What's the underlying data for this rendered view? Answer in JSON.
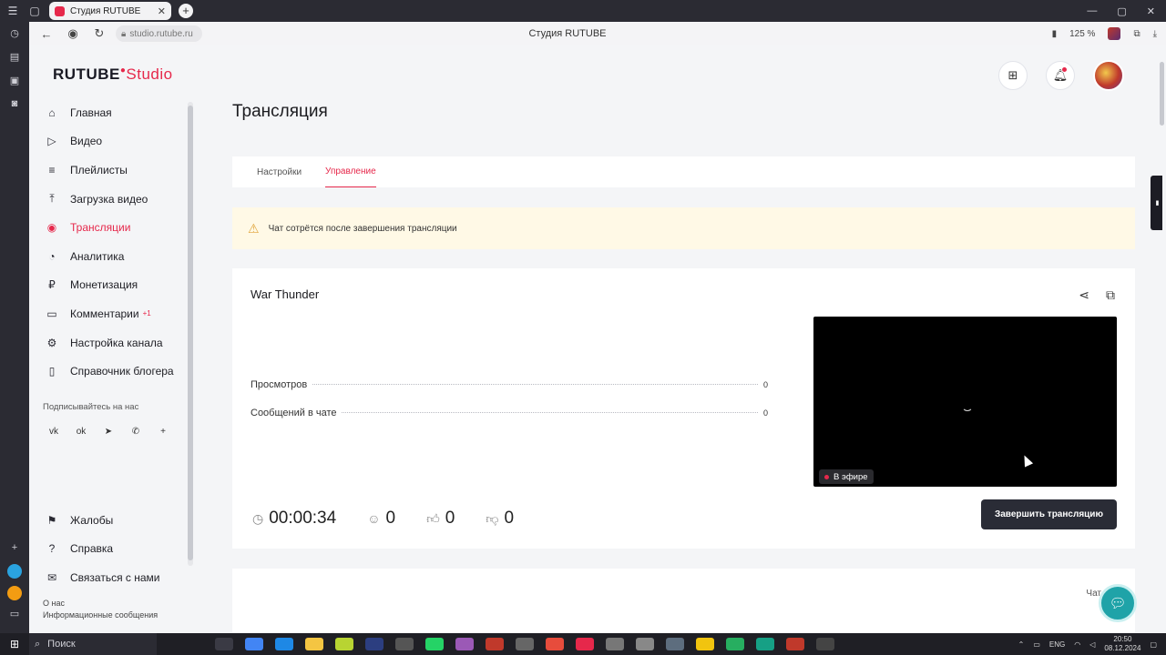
{
  "browser": {
    "tab_title": "Студия RUTUBE",
    "url": "studio.rutube.ru",
    "page_title": "Студия RUTUBE",
    "zoom": "125 %"
  },
  "site": {
    "logo_main": "RUTUBE",
    "logo_sub": "Studio",
    "sidebar": {
      "items": [
        {
          "label": "Главная",
          "icon": "home-icon"
        },
        {
          "label": "Видео",
          "icon": "video-icon"
        },
        {
          "label": "Плейлисты",
          "icon": "list-icon"
        },
        {
          "label": "Загрузка видео",
          "icon": "upload-icon"
        },
        {
          "label": "Трансляции",
          "icon": "broadcast-icon",
          "active": true
        },
        {
          "label": "Аналитика",
          "icon": "analytics-icon"
        },
        {
          "label": "Монетизация",
          "icon": "coin-icon"
        },
        {
          "label": "Комментарии",
          "icon": "comment-icon",
          "badge": "+1"
        },
        {
          "label": "Настройка канала",
          "icon": "settings-icon"
        },
        {
          "label": "Справочник блогера",
          "icon": "book-icon"
        }
      ],
      "subscribe_label": "Подписывайтесь на нас",
      "bottom_items": [
        {
          "label": "Жалобы",
          "icon": "flag-icon"
        },
        {
          "label": "Справка",
          "icon": "help-icon"
        },
        {
          "label": "Связаться с нами",
          "icon": "mail-icon"
        }
      ],
      "about_1": "О нас",
      "about_2": "Информационные сообщения"
    },
    "page_title": "Трансляция",
    "tabs": [
      {
        "label": "Настройки",
        "active": false
      },
      {
        "label": "Управление",
        "active": true
      }
    ],
    "warning": "Чат сотрётся после завершения трансляции",
    "stream": {
      "title": "War Thunder",
      "stats": [
        {
          "label": "Просмотров",
          "value": "0"
        },
        {
          "label": "Сообщений в чате",
          "value": "0"
        }
      ],
      "live_label": "В эфире",
      "duration": "00:00:34",
      "viewers": "0",
      "likes": "0",
      "dislikes": "0",
      "end_button": "Завершить трансляцию"
    },
    "chat_label": "Чат"
  },
  "taskbar": {
    "search_label": "Поиск",
    "lang": "ENG",
    "time": "20:50",
    "date": "08.12.2024"
  },
  "colors": {
    "accent": "#e6284b",
    "dark_button": "#2a2c36",
    "warning_bg": "#fff9e6"
  }
}
